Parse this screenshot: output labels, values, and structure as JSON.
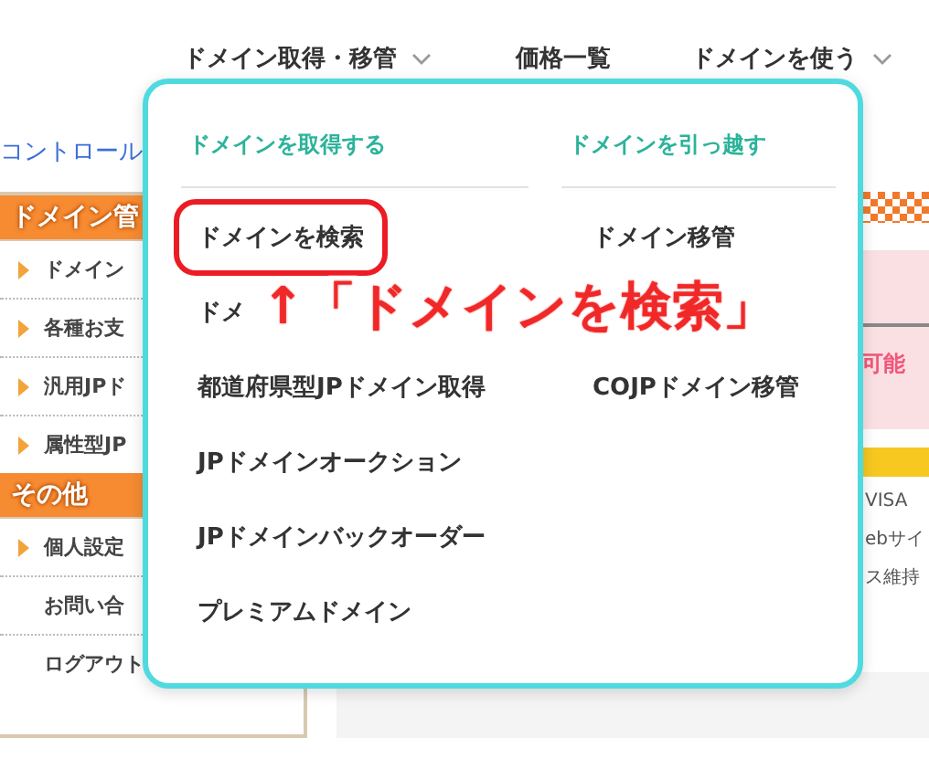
{
  "nav": [
    {
      "label": "ドメイン取得・移管",
      "kind": "menu"
    },
    {
      "label": "価格一覧",
      "kind": "link"
    },
    {
      "label": "ドメインを使う",
      "kind": "menu"
    }
  ],
  "breadcrumb_link": "コントロール",
  "sidebar": [
    {
      "kind": "header",
      "label": "ドメイン管"
    },
    {
      "kind": "item",
      "label": "ドメイン",
      "arrow": true
    },
    {
      "kind": "item",
      "label": "各種お支",
      "arrow": true
    },
    {
      "kind": "item",
      "label": "汎用JPド",
      "arrow": true
    },
    {
      "kind": "item",
      "label": "属性型JP",
      "arrow": true
    },
    {
      "kind": "header",
      "label": "その他"
    },
    {
      "kind": "item",
      "label": "個人設定",
      "arrow": true
    },
    {
      "kind": "item",
      "label": "お問い合",
      "arrow": false
    },
    {
      "kind": "item",
      "label": "ログアウト",
      "arrow": false
    }
  ],
  "content": {
    "notice_text": "可能",
    "lines": [
      "VISA",
      "ebサイ",
      "ス維持"
    ]
  },
  "dropdown": {
    "headings": [
      "ドメインを取得する",
      "ドメインを引っ越す"
    ],
    "rows": [
      {
        "left": {
          "label": "ドメインを検索",
          "highlighted": true
        },
        "right": {
          "label": "ドメイン移管",
          "highlighted": false
        }
      },
      {
        "left": {
          "label": "ドメ",
          "highlighted": false
        }
      },
      {
        "left": {
          "label": "都道府県型JPドメイン取得",
          "highlighted": false
        },
        "right": {
          "label": "COJPドメイン移管",
          "highlighted": false
        }
      },
      {
        "left": {
          "label": "JPドメインオークション",
          "highlighted": false
        }
      },
      {
        "left": {
          "label": "JPドメインバックオーダー",
          "highlighted": false
        }
      },
      {
        "left": {
          "label": "プレミアムドメイン",
          "highlighted": false
        }
      }
    ]
  },
  "annotation": {
    "text": "↑「ドメインを検索」"
  }
}
